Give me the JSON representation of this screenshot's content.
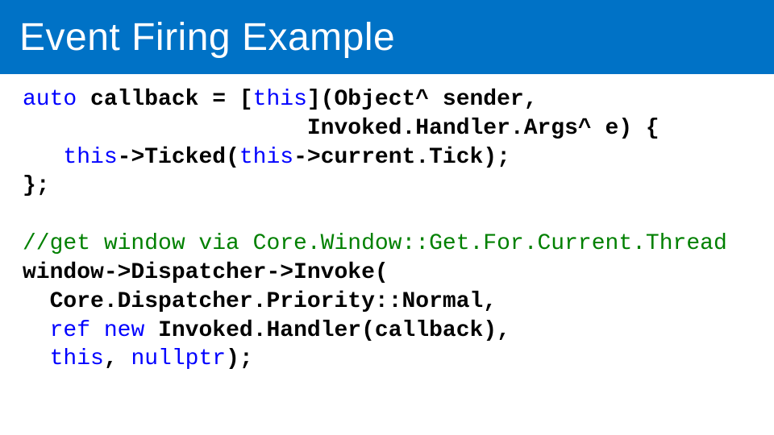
{
  "title": "Event Firing Example",
  "code": {
    "kw_auto": "auto",
    "l1": " callback = [",
    "kw_this1": "this",
    "l1b": "](Object^ sender,",
    "l2": "                     Invoked.Handler.Args^ e) {",
    "l3a": "   ",
    "kw_this2": "this",
    "l3b": "->Ticked(",
    "kw_this3": "this",
    "l3c": "->current.Tick);",
    "l4": "};",
    "blank": "",
    "cmt": "//get window via Core.Window::Get.For.Current.Thread",
    "l6": "window->Dispatcher->Invoke(",
    "l7": "  Core.Dispatcher.Priority::Normal,",
    "l8a": "  ",
    "kw_ref": "ref",
    "l8s": " ",
    "kw_new": "new",
    "l8b": " Invoked.Handler(callback),",
    "l9a": "  ",
    "kw_this4": "this",
    "l9b": ", ",
    "kw_null": "nullptr",
    "l9c": ");"
  }
}
